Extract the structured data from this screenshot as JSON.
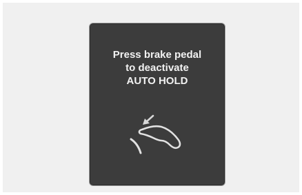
{
  "message": {
    "line1": "Press brake pedal",
    "line2": "to deactivate",
    "line3": "AUTO HOLD"
  },
  "icons": {
    "pedal": "brake-pedal-icon",
    "arrow": "press-arrow-icon"
  },
  "colors": {
    "panel": "#3c3c3c",
    "text": "#f2f2f2",
    "background": "#f0f0f0"
  }
}
